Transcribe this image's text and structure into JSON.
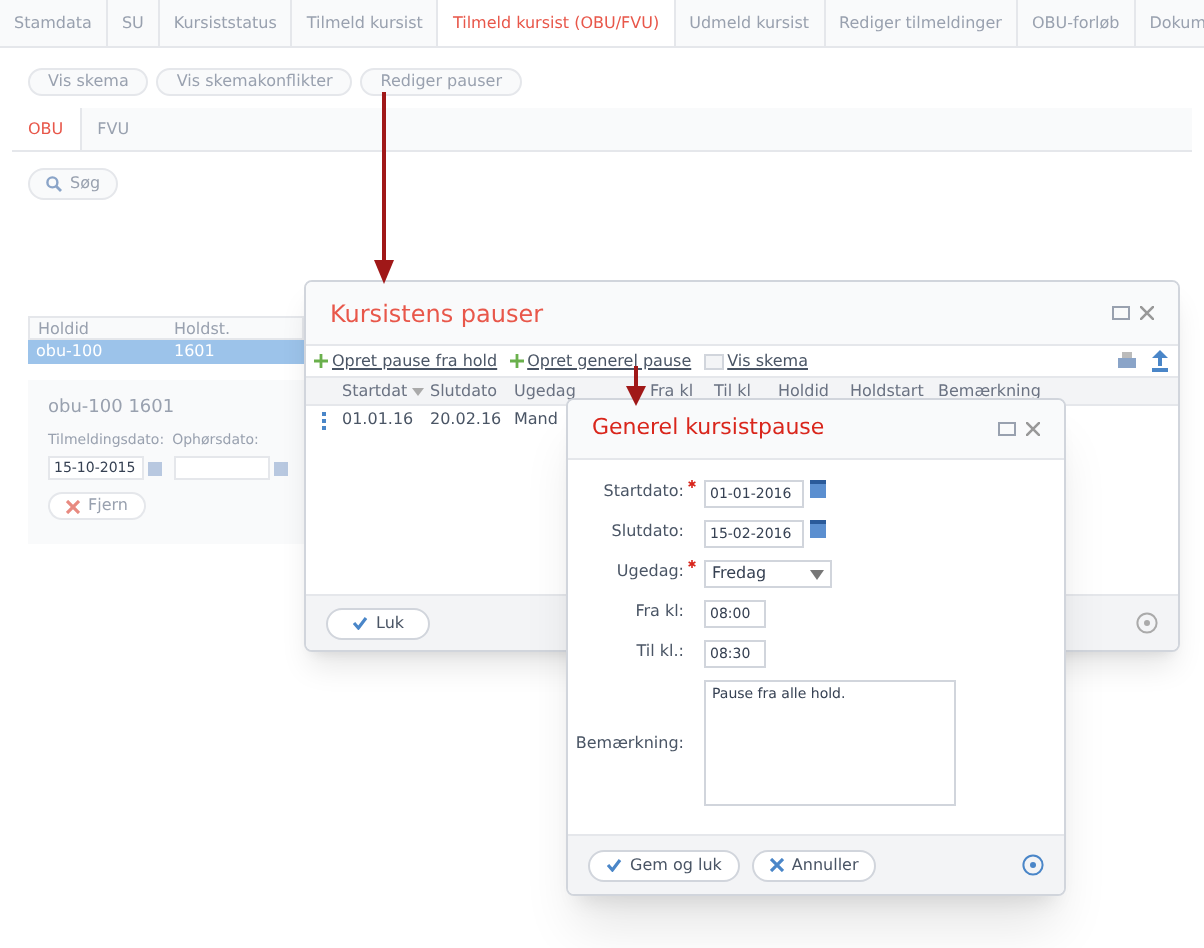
{
  "tabs": [
    {
      "label": "Stamdata",
      "selected": false
    },
    {
      "label": "SU",
      "selected": false
    },
    {
      "label": "Kursiststatus",
      "selected": false
    },
    {
      "label": "Tilmeld kursist",
      "selected": false
    },
    {
      "label": "Tilmeld kursist (OBU/FVU)",
      "selected": true
    },
    {
      "label": "Udmeld kursist",
      "selected": false
    },
    {
      "label": "Rediger tilmeldinger",
      "selected": false
    },
    {
      "label": "OBU-forløb",
      "selected": false
    },
    {
      "label": "Dokum",
      "selected": false
    }
  ],
  "toolbar_buttons": [
    "Vis skema",
    "Vis skemakonflikter",
    "Rediger pauser"
  ],
  "subtabs": [
    {
      "label": "OBU",
      "selected": true
    },
    {
      "label": "FVU",
      "selected": false
    }
  ],
  "search_button": "Søg",
  "hold_grid": {
    "columns": [
      "Holdid",
      "Holdst."
    ],
    "rows": [
      {
        "cells": [
          "obu-100",
          "1601"
        ],
        "selected": true
      }
    ]
  },
  "detail_panel": {
    "title": "obu-100 1601",
    "fields": [
      {
        "label": "Tilmeldingsdato:",
        "value": "15-10-2015"
      },
      {
        "label": "Ophørsdato:"
      }
    ],
    "remove_button": "Fjern"
  },
  "pause_dialog": {
    "title": "Kursistens pauser",
    "actions": [
      {
        "kind": "add",
        "label": "Opret pause fra hold"
      },
      {
        "kind": "add",
        "label": "Opret generel pause"
      },
      {
        "kind": "calendar",
        "label": "Vis skema"
      }
    ],
    "columns": [
      {
        "label": "Startdat",
        "sorted": true
      },
      {
        "label": "Slutdato",
        "sorted": false
      },
      {
        "label": "Ugedag",
        "sorted": false
      },
      {
        "label": "Fra kl",
        "sorted": false
      },
      {
        "label": "Til kl",
        "sorted": false
      },
      {
        "label": "Holdid",
        "sorted": false
      },
      {
        "label": "Holdstart",
        "sorted": false
      },
      {
        "label": "Bemærkning",
        "sorted": false
      }
    ],
    "rows": [
      {
        "cells": [
          "01.01.16",
          "20.02.16",
          "Mand"
        ]
      }
    ],
    "close_button": "Luk"
  },
  "general_pause_dialog": {
    "title": "Generel kursistpause",
    "fields": [
      {
        "kind": "date",
        "label": "Startdato:",
        "required": true,
        "value": "01-01-2016"
      },
      {
        "kind": "date",
        "label": "Slutdato:",
        "required": false,
        "value": "15-02-2016"
      },
      {
        "kind": "select",
        "label": "Ugedag:",
        "required": true,
        "value": "Fredag"
      },
      {
        "kind": "text",
        "label": "Fra kl:",
        "required": false,
        "value": "08:00"
      },
      {
        "kind": "text",
        "label": "Til kl.:",
        "required": false,
        "value": "08:30"
      },
      {
        "kind": "textarea",
        "label": "Bemærkning:",
        "required": false,
        "value": "Pause fra alle hold."
      }
    ],
    "buttons": [
      {
        "kind": "save",
        "label": "Gem og luk"
      },
      {
        "kind": "cancel",
        "label": "Annuller"
      }
    ]
  }
}
